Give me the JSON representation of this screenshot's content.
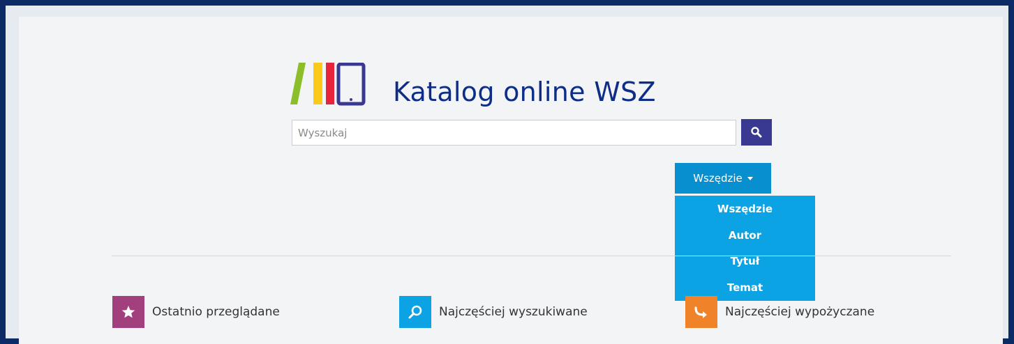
{
  "header": {
    "title": "Katalog online WSZ"
  },
  "search": {
    "placeholder": "Wyszukaj"
  },
  "scope": {
    "selected": "Wszędzie",
    "options": [
      "Wszędzie",
      "Autor",
      "Tytuł",
      "Temat"
    ]
  },
  "shortcuts": [
    {
      "label": "Ostatnio przeglądane",
      "icon": "star-icon",
      "color": "#a2407e"
    },
    {
      "label": "Najczęściej wyszukiwane",
      "icon": "magnifier-icon",
      "color": "#0ba3e3"
    },
    {
      "label": "Najczęściej wypożyczane",
      "icon": "curved-arrow-icon",
      "color": "#f0822a"
    }
  ],
  "colors": {
    "frame": "#0b2a66",
    "title": "#0d2d86",
    "search_button": "#3a3991",
    "scope_button": "#078fcf",
    "dropdown": "#0ba3e3"
  }
}
